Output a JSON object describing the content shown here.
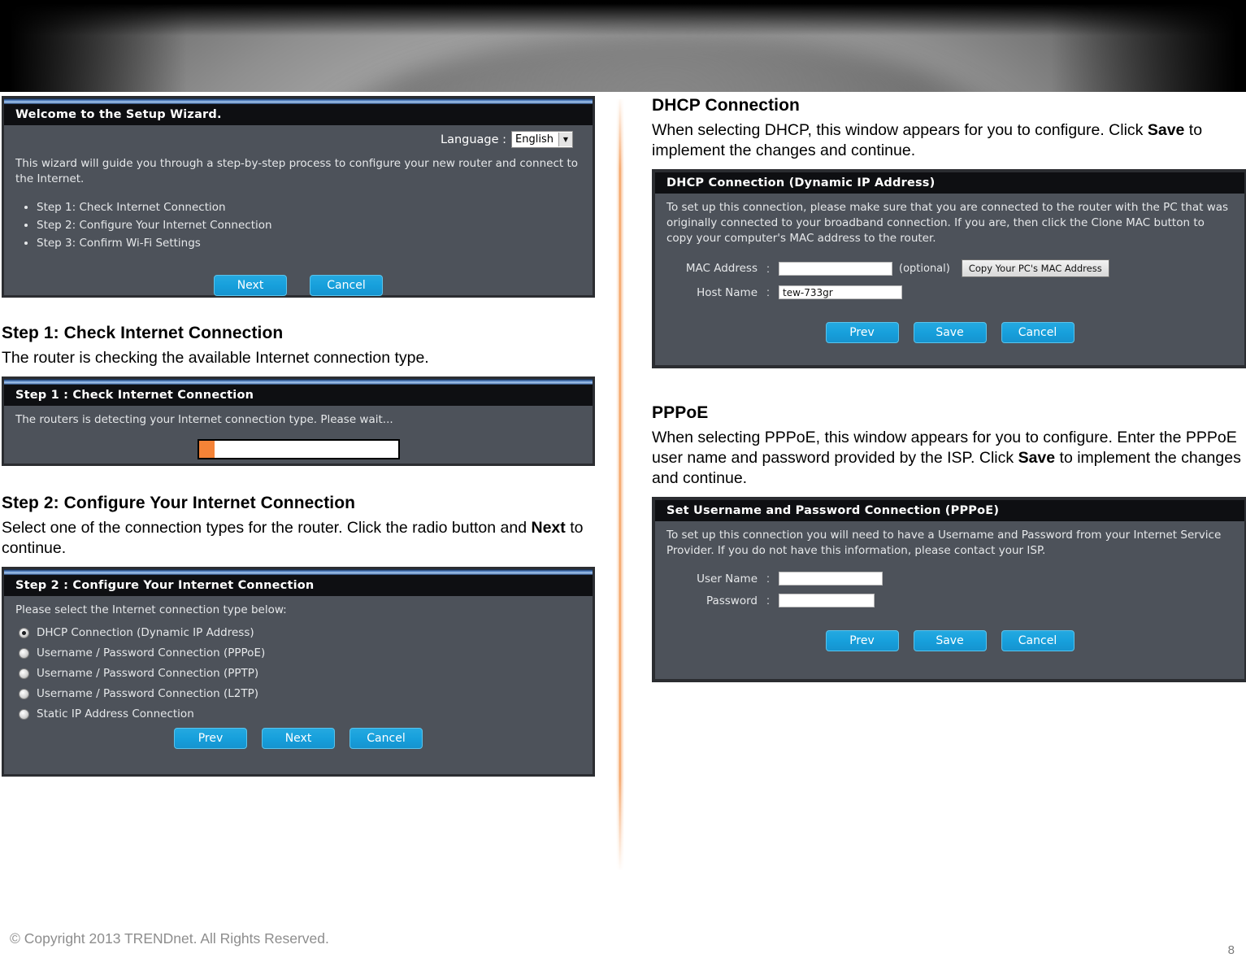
{
  "document": {
    "footer_copyright": "© Copyright 2013 TRENDnet. All Rights Reserved.",
    "page_number": "8"
  },
  "colors": {
    "accent_blue": "#17a0dc",
    "accent_orange": "#f58337",
    "panel_body": "#4d525a",
    "panel_title_bar": "#0e0f12",
    "divider_orange": "#f39650"
  },
  "left_column": {
    "welcome_panel": {
      "title": "Welcome to the Setup Wizard.",
      "language_label": "Language :",
      "language_value": "English",
      "intro": "This wizard will guide you through a step-by-step process to configure your new router and connect to the Internet.",
      "steps": [
        "Step 1: Check Internet Connection",
        "Step 2: Configure Your Internet Connection",
        "Step 3: Confirm Wi-Fi Settings"
      ],
      "buttons": {
        "next": "Next",
        "cancel": "Cancel"
      }
    },
    "step1": {
      "heading": "Step 1: Check Internet Connection",
      "body": "The router is checking the available Internet connection type.",
      "panel_title": "Step 1 : Check Internet Connection",
      "panel_text": "The routers is detecting your Internet connection type. Please wait...",
      "progress_percent": 8
    },
    "step2": {
      "heading": "Step 2: Configure Your Internet Connection",
      "body_1": "Select one of the connection types for the router. Click the radio button and ",
      "body_bold": "Next",
      "body_2": " to continue.",
      "panel_title": "Step 2 : Configure Your Internet Connection",
      "panel_text": "Please select the Internet connection type below:",
      "options": [
        {
          "label": "DHCP Connection (Dynamic IP Address)",
          "selected": true
        },
        {
          "label": "Username / Password Connection (PPPoE)",
          "selected": false
        },
        {
          "label": "Username / Password Connection (PPTP)",
          "selected": false
        },
        {
          "label": "Username / Password Connection (L2TP)",
          "selected": false
        },
        {
          "label": "Static IP Address Connection",
          "selected": false
        }
      ],
      "buttons": {
        "prev": "Prev",
        "next": "Next",
        "cancel": "Cancel"
      }
    }
  },
  "right_column": {
    "dhcp": {
      "heading": "DHCP Connection",
      "body_1": "When selecting DHCP, this window appears for you to configure. Click ",
      "body_bold": "Save",
      "body_2": " to implement the changes and continue.",
      "panel_title": "DHCP Connection (Dynamic IP Address)",
      "panel_text": "To set up this connection, please make sure that you are connected to the router with the PC that was originally connected to your broadband connection. If you are, then click the Clone MAC button to copy your computer's MAC address to the router.",
      "mac_label": "MAC Address",
      "mac_value": "",
      "mac_note": "(optional)",
      "clone_button": "Copy Your PC's MAC Address",
      "host_label": "Host Name",
      "host_value": "tew-733gr",
      "buttons": {
        "prev": "Prev",
        "save": "Save",
        "cancel": "Cancel"
      }
    },
    "pppoe": {
      "heading": "PPPoE",
      "body_1": "When selecting PPPoE, this window appears for you to configure. Enter the PPPoE user name and password provided by the ISP. Click ",
      "body_bold": "Save",
      "body_2": " to implement the changes and continue.",
      "panel_title": "Set Username and Password Connection (PPPoE)",
      "panel_text": "To set up this connection you will need to have a Username and Password from your Internet Service Provider. If you do not have this information, please contact your ISP.",
      "username_label": "User Name",
      "username_value": "",
      "password_label": "Password",
      "password_value": "",
      "colon": ":",
      "buttons": {
        "prev": "Prev",
        "save": "Save",
        "cancel": "Cancel"
      }
    }
  }
}
